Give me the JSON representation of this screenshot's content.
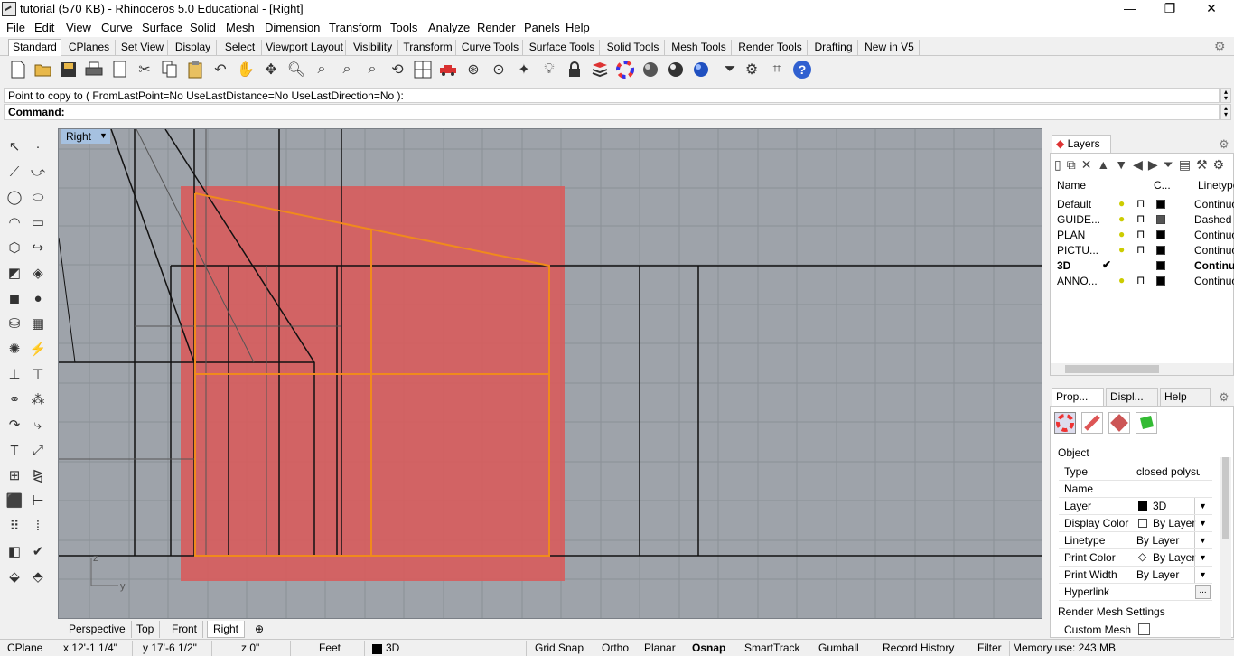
{
  "window": {
    "title": "tutorial (570 KB) - Rhinoceros 5.0 Educational - [Right]",
    "minimize": "—",
    "maximize": "❐",
    "close": "✕"
  },
  "menu": [
    "File",
    "Edit",
    "View",
    "Curve",
    "Surface",
    "Solid",
    "Mesh",
    "Dimension",
    "Transform",
    "Tools",
    "Analyze",
    "Render",
    "Panels",
    "Help"
  ],
  "toolbar_tabs": [
    "Standard",
    "CPlanes",
    "Set View",
    "Display",
    "Select",
    "Viewport Layout",
    "Visibility",
    "Transform",
    "Curve Tools",
    "Surface Tools",
    "Solid Tools",
    "Mesh Tools",
    "Render Tools",
    "Drafting",
    "New in V5"
  ],
  "toolbar_icons": [
    "new-icon",
    "open-icon",
    "save-icon",
    "print-icon",
    "import-icon",
    "cut-icon",
    "copy-icon",
    "paste-icon",
    "undo-icon",
    "pan-icon",
    "rotate-view-icon",
    "zoom-icon",
    "zoom-window-icon",
    "zoom-extents-icon",
    "zoom-selected-icon",
    "rotate-icon",
    "four-viewports-icon",
    "car-icon",
    "orbit-icon",
    "cplane-icon",
    "light-icon",
    "bulb-icon",
    "lock-icon",
    "layer-icon",
    "color-wheel-icon",
    "shade-icon",
    "render-icon",
    "rendered-sphere-icon",
    "blue-sphere-icon",
    "filter-icon",
    "settings-gear-icon",
    "snap-icon",
    "help-icon"
  ],
  "command": {
    "history": "Point to copy to ( FromLastPoint=No  UseLastDistance=No  UseLastDirection=No ):",
    "prompt": "Command:"
  },
  "viewport": {
    "name": "Right",
    "axis_z": "z",
    "axis_y": "y"
  },
  "viewport_tabs": [
    "Perspective",
    "Top",
    "Front",
    "Right"
  ],
  "status": {
    "cplane": "CPlane",
    "x": "x 12'-1 1/4\"",
    "y": "y 17'-6 1/2\"",
    "z": "z 0\"",
    "units": "Feet",
    "layer": "3D",
    "toggles": [
      "Grid Snap",
      "Ortho",
      "Planar",
      "Osnap",
      "SmartTrack",
      "Gumball",
      "Record History",
      "Filter"
    ],
    "active_toggle": "Osnap",
    "memory": "Memory use: 243 MB"
  },
  "layers": {
    "tab": "Layers",
    "columns": {
      "name": "Name",
      "color": "C...",
      "linetype": "Linetype"
    },
    "rows": [
      {
        "name": "Default",
        "current": "",
        "color": "#000000",
        "linetype": "Continuo",
        "bold": false
      },
      {
        "name": "GUIDE...",
        "current": "",
        "color": "#555555",
        "linetype": "Dashed",
        "bold": false
      },
      {
        "name": "PLAN",
        "current": "",
        "color": "#000000",
        "linetype": "Continuo",
        "bold": false
      },
      {
        "name": "PICTU...",
        "current": "",
        "color": "#000000",
        "linetype": "Continuo",
        "bold": false
      },
      {
        "name": "3D",
        "current": "✔",
        "color": "#000000",
        "linetype": "Continu",
        "bold": true
      },
      {
        "name": "ANNO...",
        "current": "",
        "color": "#000000",
        "linetype": "Continuo",
        "bold": false
      }
    ]
  },
  "properties": {
    "tabs": [
      "Prop...",
      "Displ...",
      "Help"
    ],
    "section_object": "Object",
    "rows": [
      {
        "label": "Type",
        "value": "closed polysurf...",
        "dropdown": false
      },
      {
        "label": "Name",
        "value": "",
        "dropdown": false
      },
      {
        "label": "Layer",
        "value": "3D",
        "dropdown": true
      },
      {
        "label": "Display Color",
        "value": "By Layer",
        "dropdown": true
      },
      {
        "label": "Linetype",
        "value": "By Layer",
        "dropdown": true
      },
      {
        "label": "Print Color",
        "value": "By Layer",
        "dropdown": true
      },
      {
        "label": "Print Width",
        "value": "By Layer",
        "dropdown": true
      },
      {
        "label": "Hyperlink",
        "value": "",
        "dropdown": false
      }
    ],
    "hyperlink_btn": "...",
    "section_render": "Render Mesh Settings",
    "custom_mesh": "Custom Mesh"
  }
}
